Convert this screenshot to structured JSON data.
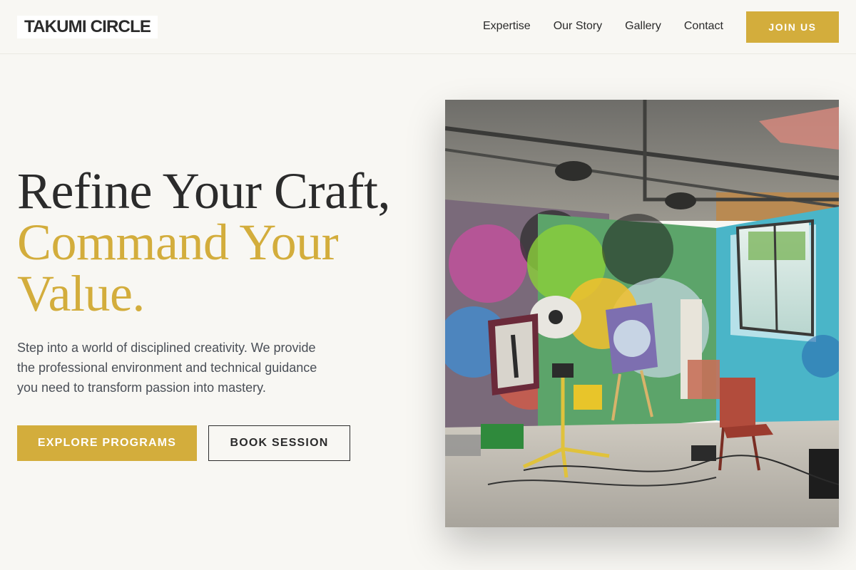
{
  "header": {
    "logo": "TAKUMI CIRCLE",
    "nav": [
      "Expertise",
      "Our Story",
      "Gallery",
      "Contact"
    ],
    "join_label": "JOIN US"
  },
  "hero": {
    "title_line1": "Refine Your Craft,",
    "title_line2": "Command Your Value.",
    "description": "Step into a world of disciplined creativity. We provide the professional environment and technical guidance you need to transform passion into mastery.",
    "primary_cta": "EXPLORE PROGRAMS",
    "secondary_cta": "BOOK SESSION",
    "image_subject": "graffiti-covered art studio with easels, paintings, chairs and a window"
  },
  "colors": {
    "accent": "#d3ad3c",
    "text": "#2b2b2b",
    "background": "#f8f7f3",
    "body_text": "#4a4f57"
  }
}
